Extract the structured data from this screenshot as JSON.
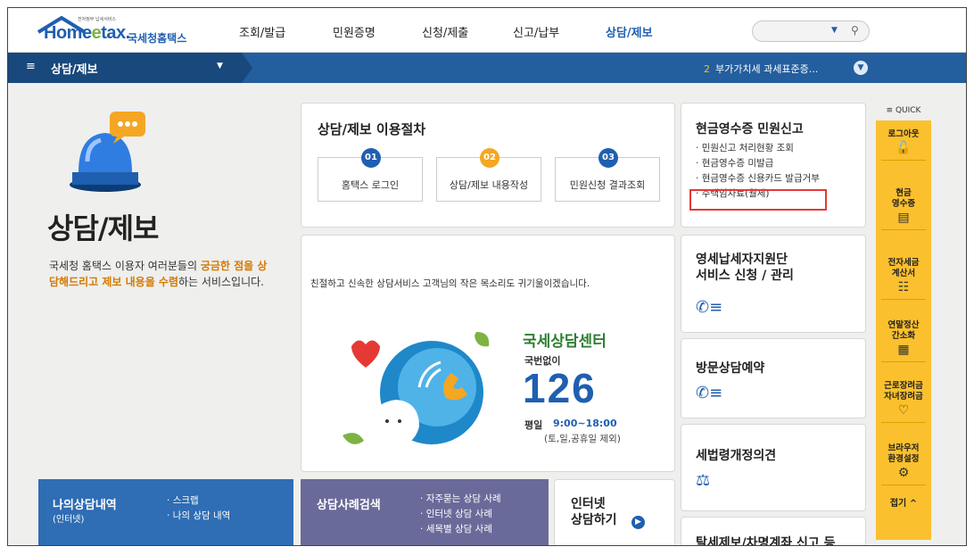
{
  "header": {
    "logo_tagline": "전자정부 납세서비스",
    "logo_home": "Home",
    "logo_e": "e",
    "logo_tax": "tax.",
    "logo_sub": "국세청홈택스",
    "nav": [
      "조회/발급",
      "민원증명",
      "신청/제출",
      "신고/납부",
      "상담/제보"
    ],
    "search_placeholder": ""
  },
  "bluebar": {
    "breadcrumb": "상담/제보",
    "ticker_num": "2",
    "ticker_text": "부가가치세 과세표준증..."
  },
  "hero": {
    "title": "상담/제보",
    "desc_1": "국세청 홈택스 이용자 여러분들의 ",
    "desc_hl1": "궁금한 점을 상담해드리고 제보 내용을 수렴",
    "desc_2": "하는 서비스입니다."
  },
  "procedure": {
    "title": "상담/제보 이용절차",
    "steps": [
      {
        "num": "01",
        "label": "홈택스 로그인",
        "color": "#1f5fb0"
      },
      {
        "num": "02",
        "label": "상담/제보 내용작성",
        "color": "#f5a623"
      },
      {
        "num": "03",
        "label": "민원신청 결과조회",
        "color": "#1f5fb0"
      }
    ]
  },
  "cash_receipt": {
    "title": "현금영수증 민원신고",
    "items": [
      "민원신고 처리현황 조회",
      "현금영수증 미발급",
      "현금영수증 신용카드 발급거부",
      "주택임차료(월세)"
    ]
  },
  "center": {
    "message": "친절하고 신속한 상담서비스 고객님의 작은 목소리도 귀기울이겠습니다.",
    "logo_text": "국세상담센터",
    "no_area_code": "국번없이",
    "number": "126",
    "hours_label": "평일",
    "hours": "9:00~18:00",
    "closed": "(토,일,공휴일 제외)"
  },
  "side_cards": {
    "small_biz": "영세납세자지원단\n서비스 신청 / 관리",
    "visit": "방문상담예약",
    "tax_law": "세법령개정의견",
    "report": "탈세제보/차명계좌 신고 등"
  },
  "bottom": {
    "my_history_title": "나의상담내역",
    "my_history_sub": "(인터넷)",
    "my_history_items": [
      "스크랩",
      "나의 상담 내역"
    ],
    "case_title": "상담사례검색",
    "case_items": [
      "자주묻는 상담 사례",
      "인터넷 상담 사례",
      "세목별 상담 사례"
    ],
    "internet": "인터넷\n상담하기"
  },
  "quick": {
    "header": "QUICK",
    "items": [
      "로그아웃",
      "현금\n영수증",
      "전자세금\n계산서",
      "연말정산\n간소화",
      "근로장려금\n자녀장려금",
      "브라우저\n환경설정"
    ],
    "icons": [
      "lock-icon",
      "receipt-icon",
      "invoice-icon",
      "calculator-icon",
      "heart-icon",
      "gear-icon"
    ],
    "fold": "접기"
  }
}
